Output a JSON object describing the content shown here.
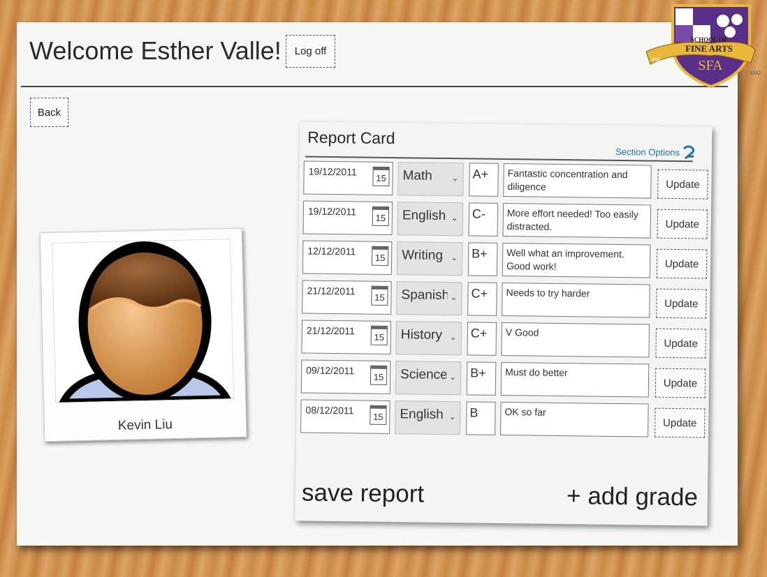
{
  "header": {
    "welcome": "Welcome Esther Valle!",
    "logoff_label": "Log off",
    "back_label": "Back"
  },
  "logo": {
    "line1": "SCHOOL OF",
    "line2": "FINE ARTS",
    "initials": "SFA",
    "est_label": "est.",
    "year": "1842"
  },
  "student": {
    "name": "Kevin Liu"
  },
  "report": {
    "title": "Report Card",
    "section_options": "Section Options",
    "rows": [
      {
        "date": "19/12/2011",
        "cal_day": "15",
        "subject": "Math",
        "grade": "A+",
        "comment": "Fantastic concentration and diligence",
        "update": "Update"
      },
      {
        "date": "19/12/2011",
        "cal_day": "15",
        "subject": "English",
        "grade": "C-",
        "comment": "More effort needed! Too easily distracted.",
        "update": "Update"
      },
      {
        "date": "12/12/2011",
        "cal_day": "15",
        "subject": "Writing",
        "grade": "B+",
        "comment": "Well what an improvement. Good work!",
        "update": "Update"
      },
      {
        "date": "21/12/2011",
        "cal_day": "15",
        "subject": "Spanish",
        "grade": "C+",
        "comment": "Needs to try harder",
        "update": "Update"
      },
      {
        "date": "21/12/2011",
        "cal_day": "15",
        "subject": "History",
        "grade": "C+",
        "comment": "V Good",
        "update": "Update"
      },
      {
        "date": "09/12/2011",
        "cal_day": "15",
        "subject": "Science",
        "grade": "B+",
        "comment": "Must do better",
        "update": "Update"
      },
      {
        "date": "08/12/2011",
        "cal_day": "15",
        "subject": "English",
        "grade": "B",
        "comment": "OK so far",
        "update": "Update"
      }
    ],
    "save_label": "save report",
    "add_label": "+ add grade"
  },
  "colors": {
    "accent": "#1a73b8",
    "shield": "#5a2f8a",
    "banner": "#e8b83a"
  }
}
